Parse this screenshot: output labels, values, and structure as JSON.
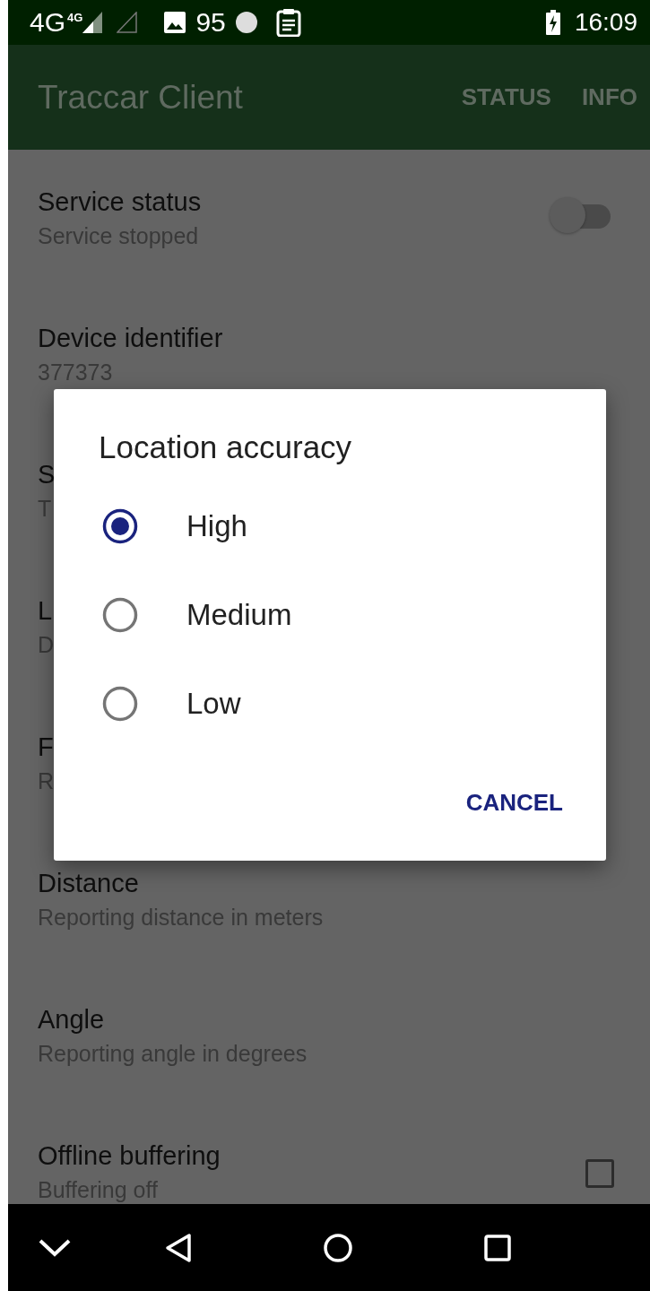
{
  "status_bar": {
    "network": "4G",
    "network_small": "4G",
    "notification_count": "95",
    "time": "16:09"
  },
  "app_bar": {
    "title": "Traccar Client",
    "actions": [
      "STATUS",
      "INFO"
    ]
  },
  "settings": [
    {
      "kind": "switch",
      "title": "Service status",
      "summary": "Service stopped",
      "on": false
    },
    {
      "kind": "text",
      "title": "Device identifier",
      "summary": "377373"
    },
    {
      "kind": "text",
      "title": "S",
      "summary": "T"
    },
    {
      "kind": "text",
      "title": "L",
      "summary": "D"
    },
    {
      "kind": "text",
      "title": "F",
      "summary": "R"
    },
    {
      "kind": "text",
      "title": "Distance",
      "summary": "Reporting distance in meters"
    },
    {
      "kind": "text",
      "title": "Angle",
      "summary": "Reporting angle in degrees"
    },
    {
      "kind": "checkbox",
      "title": "Offline buffering",
      "summary": "Buffering off",
      "checked": false
    }
  ],
  "dialog": {
    "title": "Location accuracy",
    "options": [
      {
        "label": "High",
        "selected": true
      },
      {
        "label": "Medium",
        "selected": false
      },
      {
        "label": "Low",
        "selected": false
      }
    ],
    "buttons": [
      "CANCEL"
    ]
  }
}
